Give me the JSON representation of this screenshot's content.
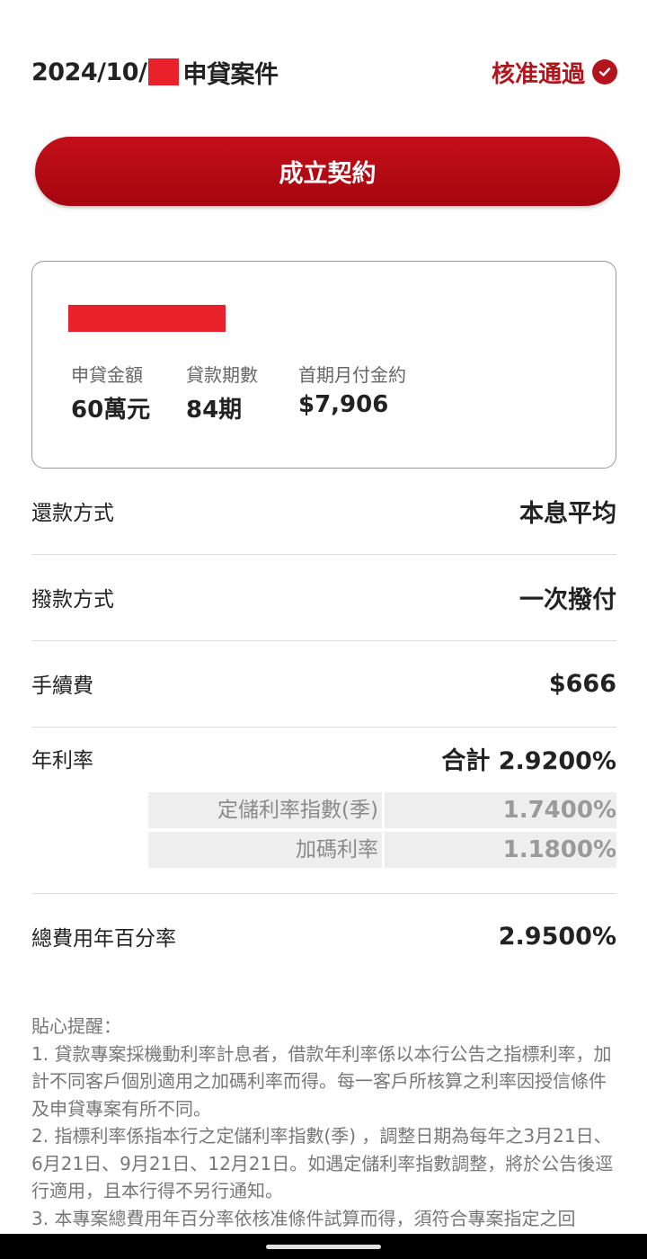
{
  "header": {
    "date_prefix": "2024/10/",
    "title_suffix": "申貸案件",
    "status_label": "核准通過",
    "status_icon": "check-circle-icon",
    "status_color": "#b3141c"
  },
  "primary_button": {
    "label": "成立契約",
    "color": "#b3141c"
  },
  "summary": {
    "amount_label": "申貸金額",
    "amount_value": "60萬元",
    "term_label": "貸款期數",
    "term_value": "84期",
    "first_payment_label": "首期月付金約",
    "first_payment_value": "$7,906"
  },
  "details": {
    "repayment": {
      "label": "還款方式",
      "value": "本息平均"
    },
    "disbursement": {
      "label": "撥款方式",
      "value": "一次撥付"
    },
    "fee": {
      "label": "手續費",
      "value": "$666"
    },
    "rate": {
      "label": "年利率",
      "value": "合計 2.9200%",
      "components": [
        {
          "label": "定儲利率指數(季)",
          "value": "1.7400%"
        },
        {
          "label": "加碼利率",
          "value": "1.1800%"
        }
      ]
    },
    "apr": {
      "label": "總費用年百分率",
      "value": "2.9500%"
    }
  },
  "notes": {
    "title": "貼心提醒：",
    "items": [
      "1. 貸款專案採機動利率計息者，借款年利率係以本行公告之指標利率，加計不同客戶個別適用之加碼利率而得。每一客戶所核算之利率因授信條件及申貸專案有所不同。",
      "2. 指標利率係指本行之定儲利率指數(季) ，調整日期為每年之3月21日、6月21日、9月21日、12月21日。如遇定儲利率指數調整，將於公告後逕行適用，且本行得不另行通知。",
      "3. 本專案總費用年百分率依核准條件試算而得，須符合專案指定之回"
    ]
  }
}
